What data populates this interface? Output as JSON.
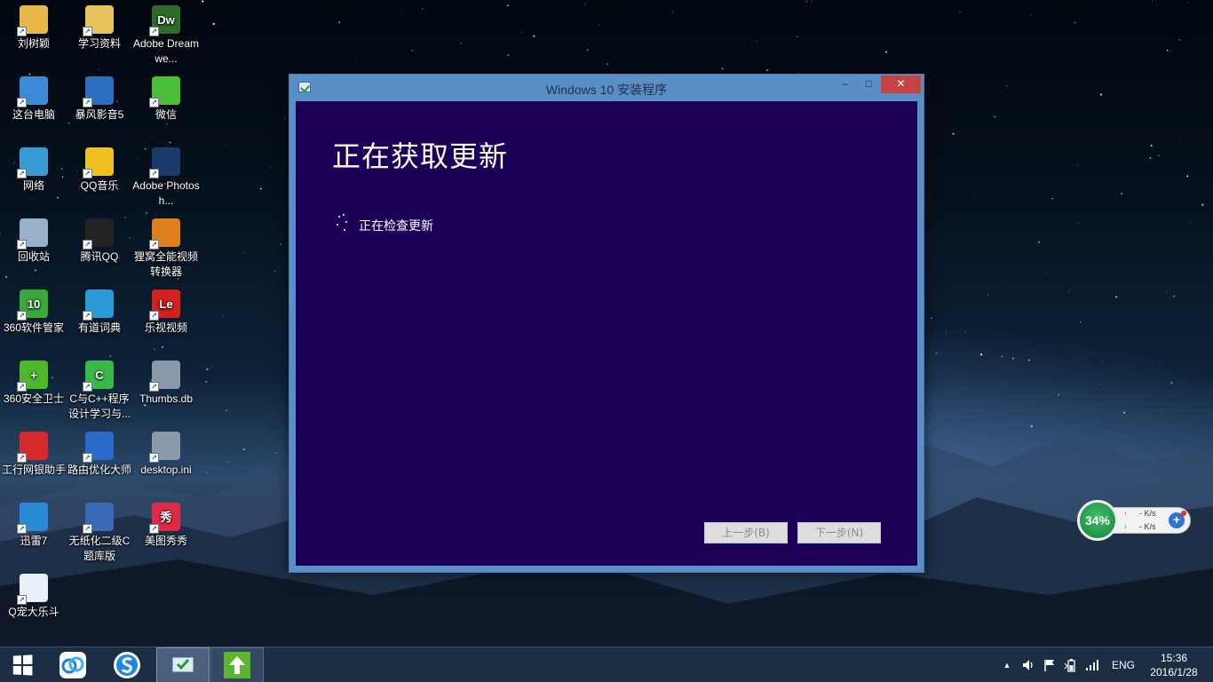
{
  "desktop": {
    "icons": [
      {
        "label": "刘树颖",
        "icon": "user-folder-icon",
        "color": "#e8b84a"
      },
      {
        "label": "学习资料",
        "icon": "folder-icon",
        "color": "#e8c25a"
      },
      {
        "label": "Adobe Dreamwe...",
        "icon": "dreamweaver-icon",
        "color": "#2f6b2a",
        "text": "Dw"
      },
      {
        "label": "这台电脑",
        "icon": "computer-icon",
        "color": "#3a8ad6"
      },
      {
        "label": "暴风影音5",
        "icon": "baofeng-icon",
        "color": "#2c6fbf"
      },
      {
        "label": "微信",
        "icon": "wechat-icon",
        "color": "#4bbf3a"
      },
      {
        "label": "网络",
        "icon": "network-icon",
        "color": "#3a9ad6"
      },
      {
        "label": "QQ音乐",
        "icon": "qqmusic-icon",
        "color": "#f0c020"
      },
      {
        "label": "Adobe Photosh...",
        "icon": "photoshop-icon",
        "color": "#1a3a6a"
      },
      {
        "label": "回收站",
        "icon": "recycle-bin-icon",
        "color": "#9ab0c8"
      },
      {
        "label": "腾讯QQ",
        "icon": "qq-icon",
        "color": "#222222"
      },
      {
        "label": "狸窝全能视频转换器",
        "icon": "video-converter-icon",
        "color": "#e0801a"
      },
      {
        "label": "360软件管家",
        "icon": "360-software-icon",
        "color": "#3aa83a",
        "text": "10"
      },
      {
        "label": "有道词典",
        "icon": "youdao-icon",
        "color": "#2a9ad6"
      },
      {
        "label": "乐视视频",
        "icon": "letv-icon",
        "color": "#d42020",
        "text": "Le"
      },
      {
        "label": "360安全卫士",
        "icon": "360-safe-icon",
        "color": "#4cb82a",
        "text": "+"
      },
      {
        "label": "C与C++程序设计学习与...",
        "icon": "c-program-icon",
        "color": "#3ab84a",
        "text": "C"
      },
      {
        "label": "Thumbs.db",
        "icon": "file-db-icon",
        "color": "#8a9aaa"
      },
      {
        "label": "工行网银助手",
        "icon": "icbc-icon",
        "color": "#d42a2a"
      },
      {
        "label": "路由优化大师",
        "icon": "router-icon",
        "color": "#2a6ac8"
      },
      {
        "label": "desktop.ini",
        "icon": "file-ini-icon",
        "color": "#8a9aaa"
      },
      {
        "label": "迅雷7",
        "icon": "xunlei-icon",
        "color": "#2a8ad6"
      },
      {
        "label": "无纸化二级C题库版",
        "icon": "exam-icon",
        "color": "#3a6ab8"
      },
      {
        "label": "美图秀秀",
        "icon": "meitu-icon",
        "color": "#e02a4a",
        "text": "秀"
      },
      {
        "label": "Q宠大乐斗",
        "icon": "qchong-icon",
        "color": "#e8f0f8"
      }
    ]
  },
  "window": {
    "title": "Windows 10 安装程序",
    "minimize": "–",
    "maximize": "□",
    "close": "✕",
    "heading": "正在获取更新",
    "status": "正在检查更新",
    "back_button": "上一步(B)",
    "next_button": "下一步(N)",
    "background": "#1b0058"
  },
  "net_widget": {
    "percent": "34%",
    "up_speed": "- K/s",
    "down_speed": "- K/s",
    "up_arrow": "↑",
    "down_arrow": "↓",
    "plus": "+"
  },
  "taskbar": {
    "apps": [
      {
        "name": "baidu-netdisk-icon"
      },
      {
        "name": "sogou-input-icon"
      },
      {
        "name": "windows-setup-icon",
        "active": true
      },
      {
        "name": "upgrade-assistant-icon",
        "running": true
      }
    ],
    "tray": {
      "show_hidden": "▲",
      "language": "ENG",
      "time": "15:36",
      "date": "2016/1/28"
    }
  }
}
